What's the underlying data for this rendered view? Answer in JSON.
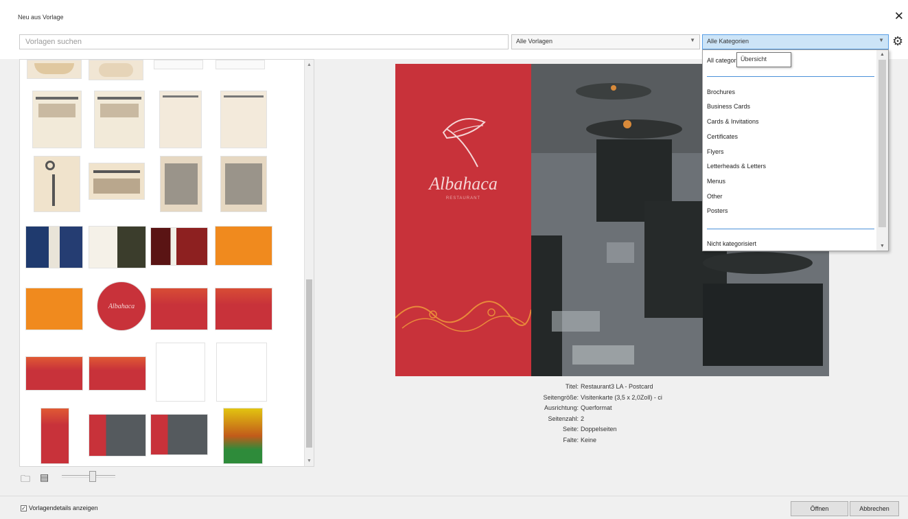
{
  "window": {
    "title": "Neu aus Vorlage"
  },
  "toolbar": {
    "search_placeholder": "Vorlagen suchen",
    "template_filter": "Alle Vorlagen",
    "category_filter": "Alle Kategorien"
  },
  "dropdown": {
    "first_item": "All categories",
    "tooltip": "Übersicht",
    "items": [
      "Brochures",
      "Business Cards",
      "Cards & Invitations",
      "Certificates",
      "Flyers",
      "Letterheads & Letters",
      "Menus",
      "Other",
      "Posters"
    ],
    "last_item": "Nicht kategorisiert"
  },
  "preview": {
    "brand_name": "Albahaca",
    "tagline": "RESTAURANT"
  },
  "details": [
    {
      "label": "Titel:",
      "value": "Restaurant3 LA - Postcard"
    },
    {
      "label": "Seitengröße:",
      "value": "Visitenkarte (3,5 x 2,0Zoll) - ci"
    },
    {
      "label": "Ausrichtung:",
      "value": "Querformat"
    },
    {
      "label": "Seitenzahl:",
      "value": "2"
    },
    {
      "label": "Seite:",
      "value": "Doppelseiten"
    },
    {
      "label": "Falte:",
      "value": "Keine"
    }
  ],
  "footer": {
    "show_details": "Vorlagendetails anzeigen",
    "open_button": "Öffnen",
    "cancel_button": "Abbrechen"
  },
  "colors": {
    "accent": "#c8323a",
    "orange": "#f08a1e",
    "selection": "#cce4f7"
  }
}
